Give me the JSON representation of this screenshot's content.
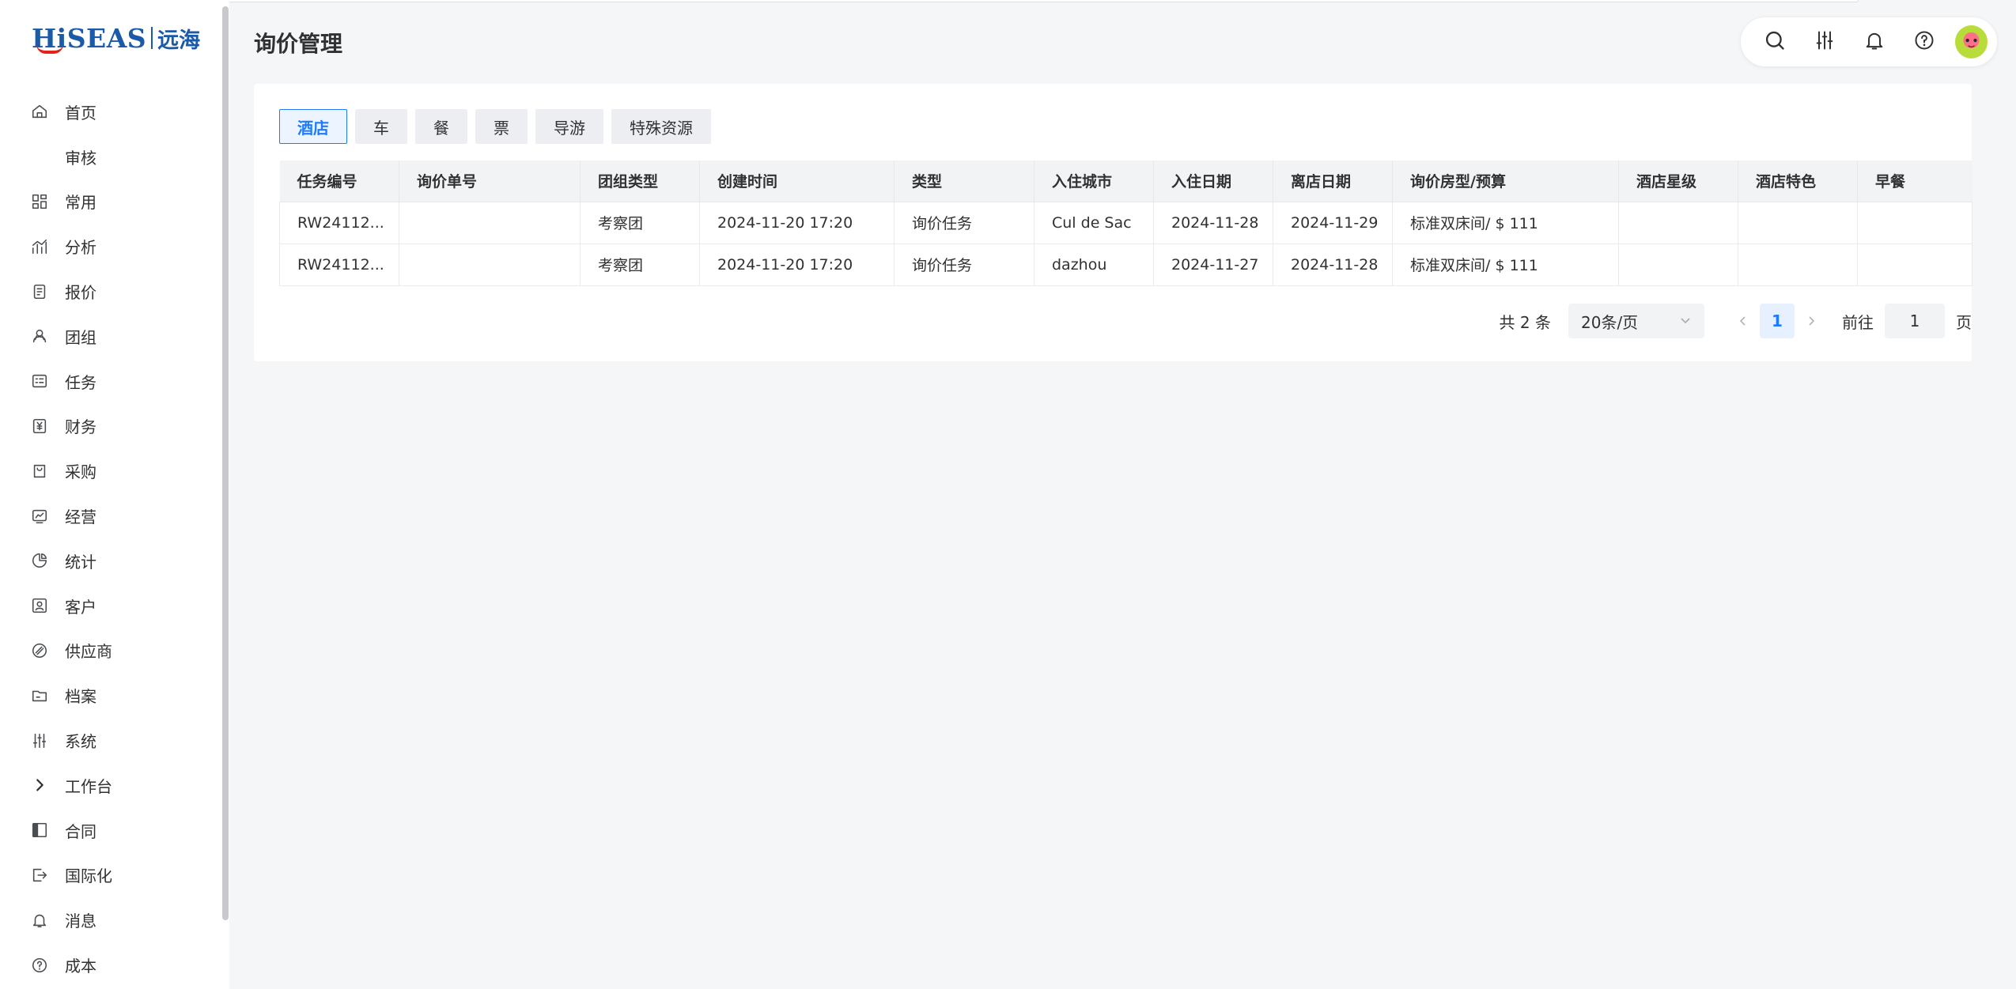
{
  "logo": {
    "en": "HiSEAS",
    "cn": "远海"
  },
  "nav": [
    {
      "label": "首页",
      "icon": "home-icon"
    },
    {
      "label": "审核",
      "icon": ""
    },
    {
      "label": "常用",
      "icon": "grid-icon"
    },
    {
      "label": "分析",
      "icon": "analysis-icon"
    },
    {
      "label": "报价",
      "icon": "quote-icon"
    },
    {
      "label": "团组",
      "icon": "group-icon"
    },
    {
      "label": "任务",
      "icon": "task-icon"
    },
    {
      "label": "财务",
      "icon": "finance-icon"
    },
    {
      "label": "采购",
      "icon": "purchase-icon"
    },
    {
      "label": "经营",
      "icon": "operation-icon"
    },
    {
      "label": "统计",
      "icon": "pie-icon"
    },
    {
      "label": "客户",
      "icon": "customer-icon"
    },
    {
      "label": "供应商",
      "icon": "supplier-icon"
    },
    {
      "label": "档案",
      "icon": "folder-icon"
    },
    {
      "label": "系统",
      "icon": "sliders-icon"
    },
    {
      "label": "工作台",
      "icon": "chevron-right-icon"
    },
    {
      "label": "合同",
      "icon": "contract-icon"
    },
    {
      "label": "国际化",
      "icon": "logout-icon"
    },
    {
      "label": "消息",
      "icon": "bell-icon"
    },
    {
      "label": "成本",
      "icon": "help-icon"
    }
  ],
  "header": {
    "title": "询价管理"
  },
  "toolbar": [
    "search-icon",
    "sliders-icon",
    "bell-icon",
    "help-icon"
  ],
  "tabs": [
    {
      "label": "酒店",
      "active": true
    },
    {
      "label": "车",
      "active": false
    },
    {
      "label": "餐",
      "active": false
    },
    {
      "label": "票",
      "active": false
    },
    {
      "label": "导游",
      "active": false
    },
    {
      "label": "特殊资源",
      "active": false
    }
  ],
  "table": {
    "columns": [
      "任务编号",
      "询价单号",
      "团组类型",
      "创建时间",
      "类型",
      "入住城市",
      "入住日期",
      "离店日期",
      "询价房型/预算",
      "酒店星级",
      "酒店特色",
      "早餐"
    ],
    "rows": [
      [
        "RW24112...",
        "",
        "考察团",
        "2024-11-20 17:20",
        "询价任务",
        "Cul de Sac",
        "2024-11-28",
        "2024-11-29",
        "标准双床间/ $ 111",
        "",
        "",
        ""
      ],
      [
        "RW24112...",
        "",
        "考察团",
        "2024-11-20 17:20",
        "询价任务",
        "dazhou",
        "2024-11-27",
        "2024-11-28",
        "标准双床间/ $ 111",
        "",
        "",
        ""
      ]
    ]
  },
  "pager": {
    "total": "共 2 条",
    "page_size": "20条/页",
    "current_page": "1",
    "goto_label": "前往",
    "goto_value": "1",
    "goto_suffix": "页"
  },
  "colors": {
    "accent": "#1e7bff",
    "brand": "#1a5aa8",
    "brand_red": "#e2231a"
  }
}
